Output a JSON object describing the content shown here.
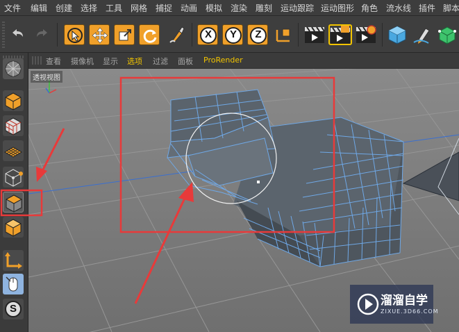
{
  "menu": [
    "文件",
    "编辑",
    "创建",
    "选择",
    "工具",
    "网格",
    "捕捉",
    "动画",
    "模拟",
    "渲染",
    "雕刻",
    "运动跟踪",
    "运动图形",
    "角色",
    "流水线",
    "插件",
    "脚本"
  ],
  "viewport_menu": [
    "查看",
    "摄像机",
    "显示",
    "选项",
    "过滤",
    "面板",
    "ProRender"
  ],
  "viewport_label": "透视视图",
  "axis_buttons": [
    "X",
    "Y",
    "Z"
  ],
  "mode_icon_letter": "S",
  "watermark": {
    "title": "溜溜自学",
    "url": "ZIXUE.3D66.COM"
  },
  "colors": {
    "accent_orange": "#f0a02a",
    "highlight_red": "#e83a3a",
    "selection_yellow": "#f2c400",
    "mesh_edge": "#6fa8e6"
  }
}
